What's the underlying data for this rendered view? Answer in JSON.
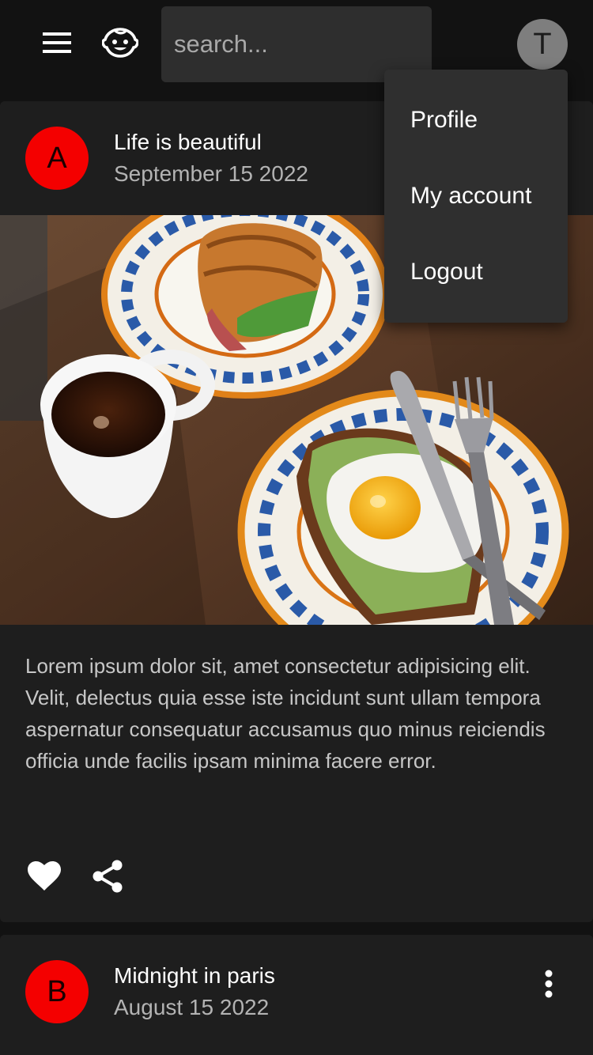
{
  "search": {
    "placeholder": "search..."
  },
  "user": {
    "initial": "T"
  },
  "user_menu": {
    "items": [
      {
        "label": "Profile"
      },
      {
        "label": "My account"
      },
      {
        "label": "Logout"
      }
    ]
  },
  "posts": [
    {
      "avatar_initial": "A",
      "avatar_color": "#f40000",
      "title": "Life is beautiful",
      "date": "September 15 2022",
      "body": "Lorem ipsum dolor sit, amet consectetur adipisicing elit. Velit, delectus quia esse iste incidunt sunt ullam tempora aspernatur consequatur accusamus quo minus reiciendis officia unde facilis ipsam minima facere error."
    },
    {
      "avatar_initial": "B",
      "avatar_color": "#f40000",
      "title": "Midnight in paris",
      "date": "August 15 2022"
    }
  ]
}
